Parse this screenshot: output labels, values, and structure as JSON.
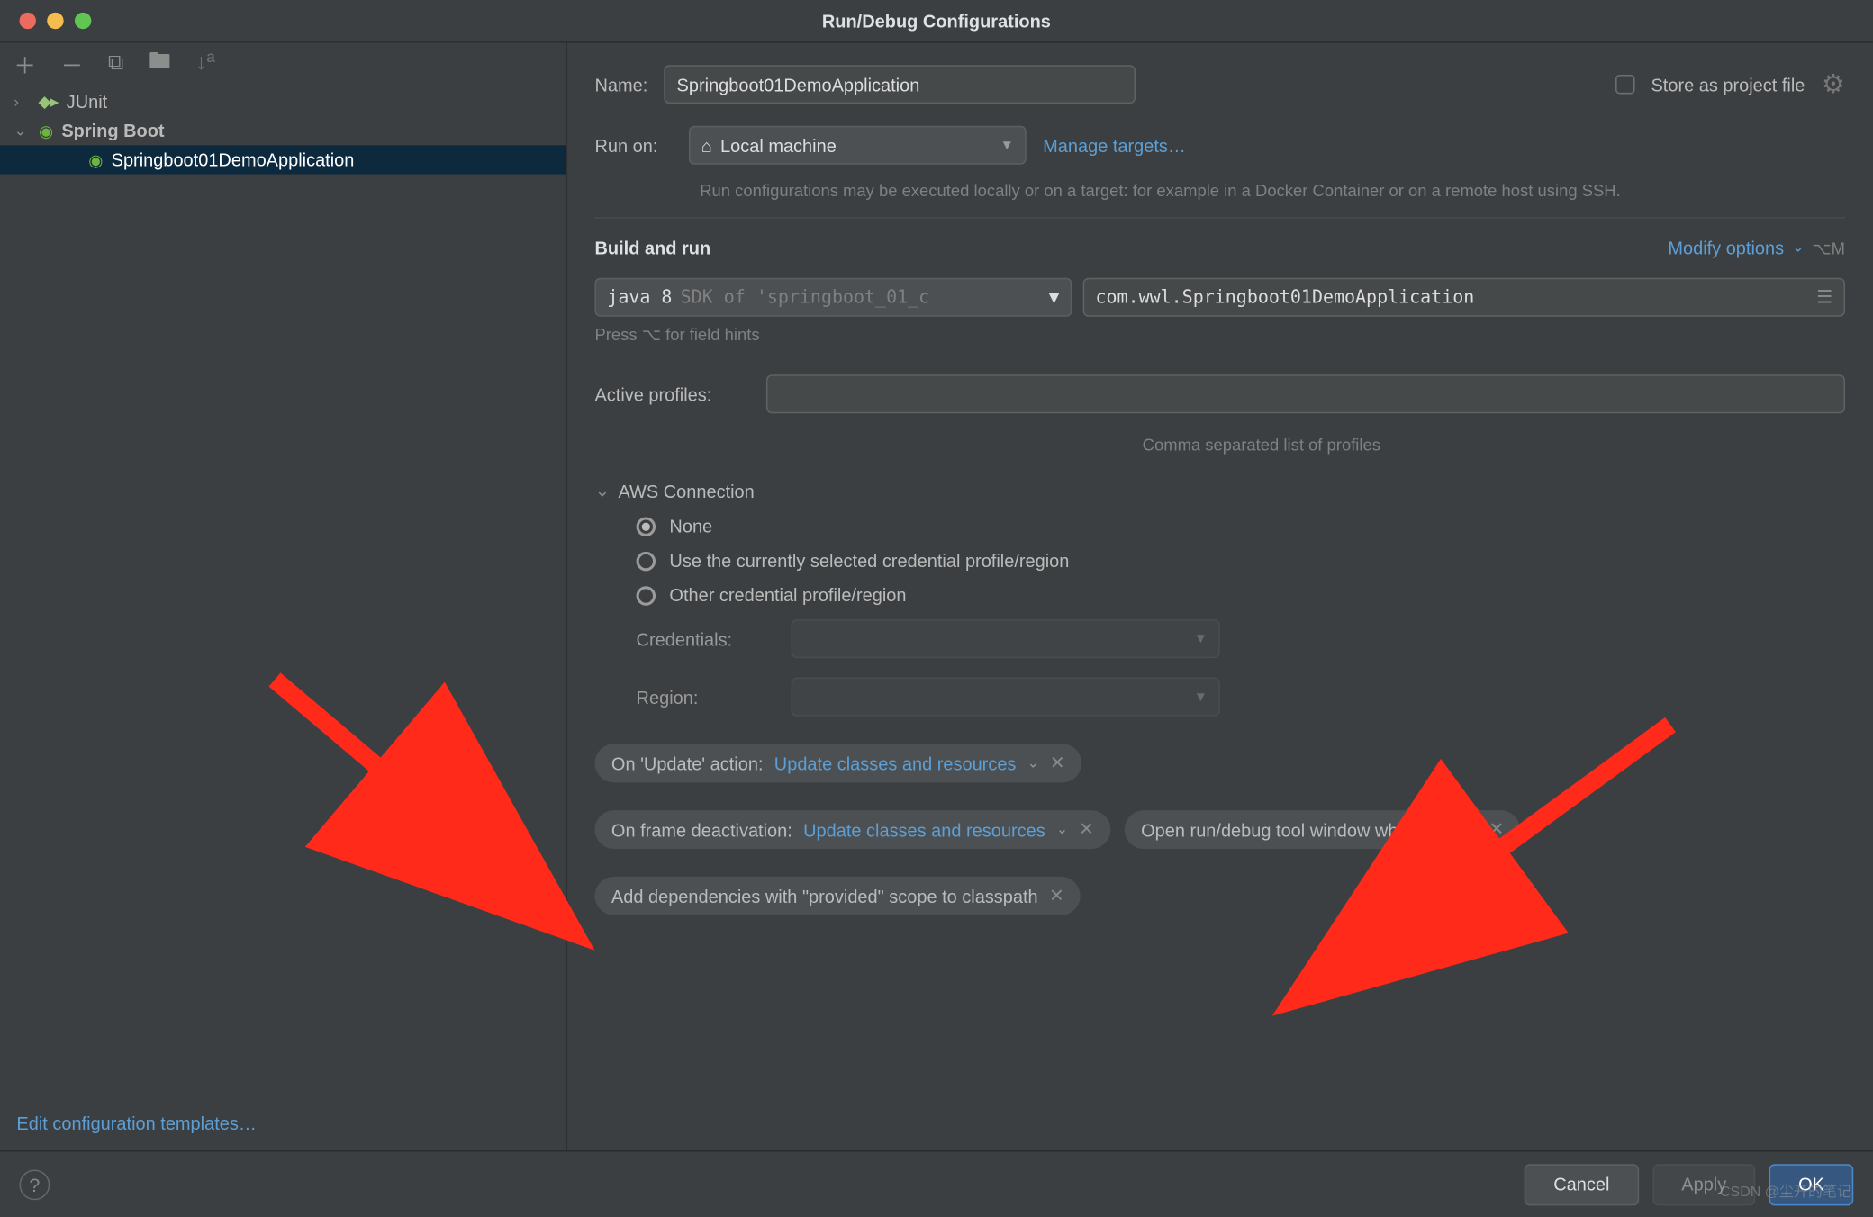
{
  "title": "Run/Debug Configurations",
  "sidebar": {
    "items": [
      {
        "label": "JUnit"
      },
      {
        "label": "Spring Boot"
      },
      {
        "label": "Springboot01DemoApplication"
      }
    ],
    "edit_templates": "Edit configuration templates…"
  },
  "name": {
    "label": "Name:",
    "value": "Springboot01DemoApplication"
  },
  "store": "Store as project file",
  "runon": {
    "label": "Run on:",
    "value": "Local machine",
    "manage": "Manage targets…",
    "note": "Run configurations may be executed locally or on a target: for example in a Docker Container or on a remote host using SSH."
  },
  "build": {
    "title": "Build and run",
    "modify": "Modify options",
    "shortcut": "⌥M",
    "java_prefix": "java 8",
    "sdk_hint": "SDK of 'springboot_01_c",
    "main_class": "com.wwl.Springboot01DemoApplication",
    "press_hint": "Press ⌥ for field hints"
  },
  "profiles": {
    "label": "Active profiles:",
    "hint": "Comma separated list of profiles"
  },
  "aws": {
    "title": "AWS Connection",
    "opts": [
      "None",
      "Use the currently selected credential profile/region",
      "Other credential profile/region"
    ],
    "credentials": "Credentials:",
    "region": "Region:"
  },
  "chips": {
    "update_action_label": "On 'Update' action:",
    "update_action_val": "Update classes and resources",
    "frame_label": "On frame deactivation:",
    "frame_val": "Update classes and resources",
    "open_tool": "Open run/debug tool window when started",
    "provided": "Add dependencies with \"provided\" scope to classpath"
  },
  "footer": {
    "cancel": "Cancel",
    "apply": "Apply",
    "ok": "OK"
  },
  "watermark": "CSDN @尘开的笔记"
}
